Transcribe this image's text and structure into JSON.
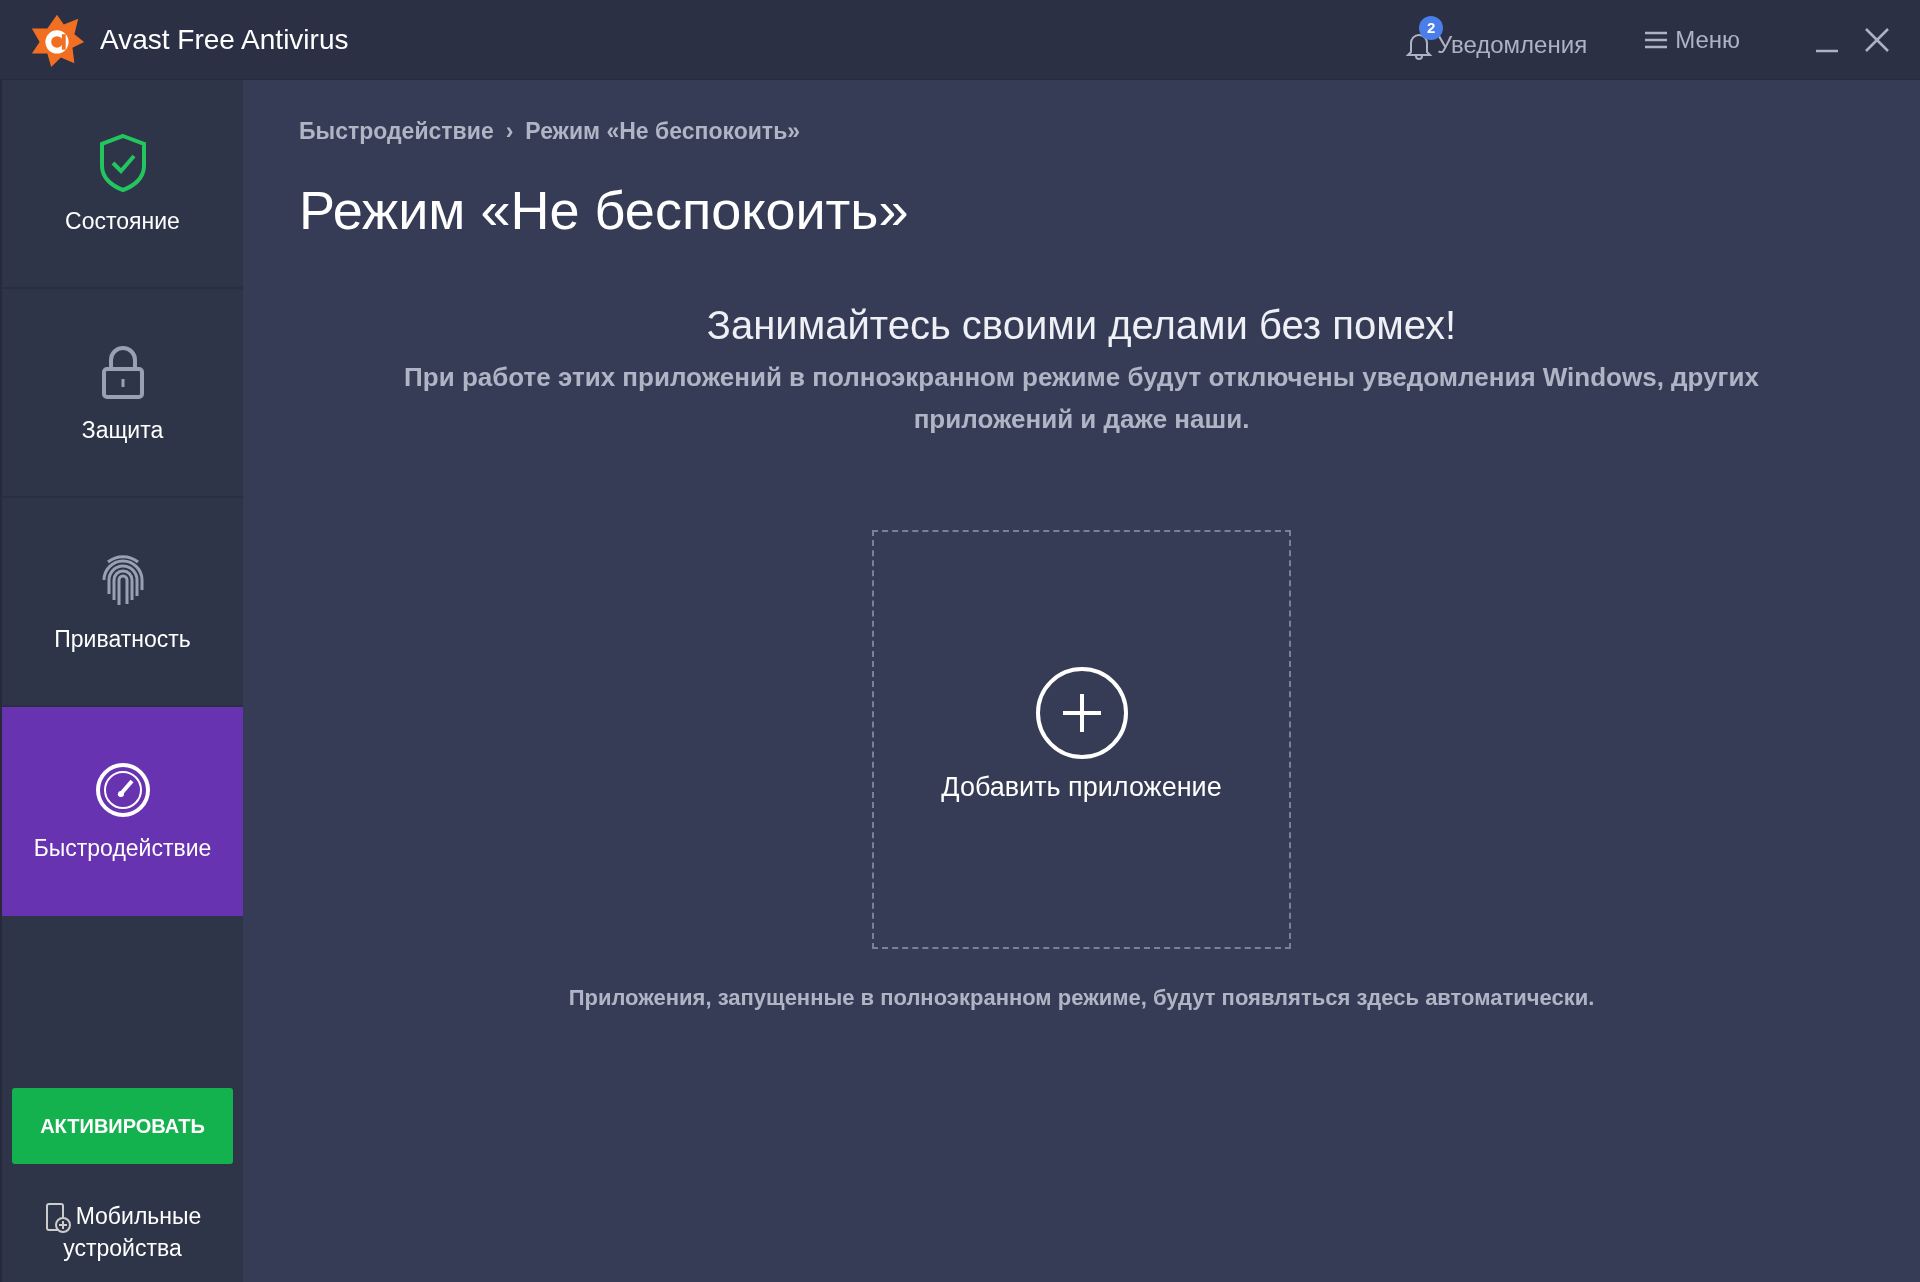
{
  "window": {
    "title": "Avast Free Antivirus",
    "notifications": {
      "label": "Уведомления",
      "count": "2"
    },
    "menu": "Меню"
  },
  "sidebar": {
    "items": [
      {
        "kind": "shield",
        "label": "Состояние",
        "selected": false
      },
      {
        "kind": "lock",
        "label": "Защита",
        "selected": false
      },
      {
        "kind": "fingerprint",
        "label": "Приватность",
        "selected": false
      },
      {
        "kind": "gauge",
        "label": "Быстродействие",
        "selected": true
      }
    ],
    "activate_button": "АКТИВИРОВАТЬ",
    "mobile_link": "Мобильные устройства"
  },
  "breadcrumb_separator": "›",
  "breadcrumb": [
    "Быстродействие",
    "Режим «Не беспокоить»"
  ],
  "page_title": "Режим «Не беспокоить»",
  "heading": "Занимайтесь своими делами без помех!",
  "description": "При работе этих приложений в полноэкранном режиме будут отключены уведомления Windows, других приложений и даже наши.",
  "add_app": "Добавить приложение",
  "footer_note": "Приложения, запущенные в полноэкранном режиме, будут появляться здесь автоматически."
}
